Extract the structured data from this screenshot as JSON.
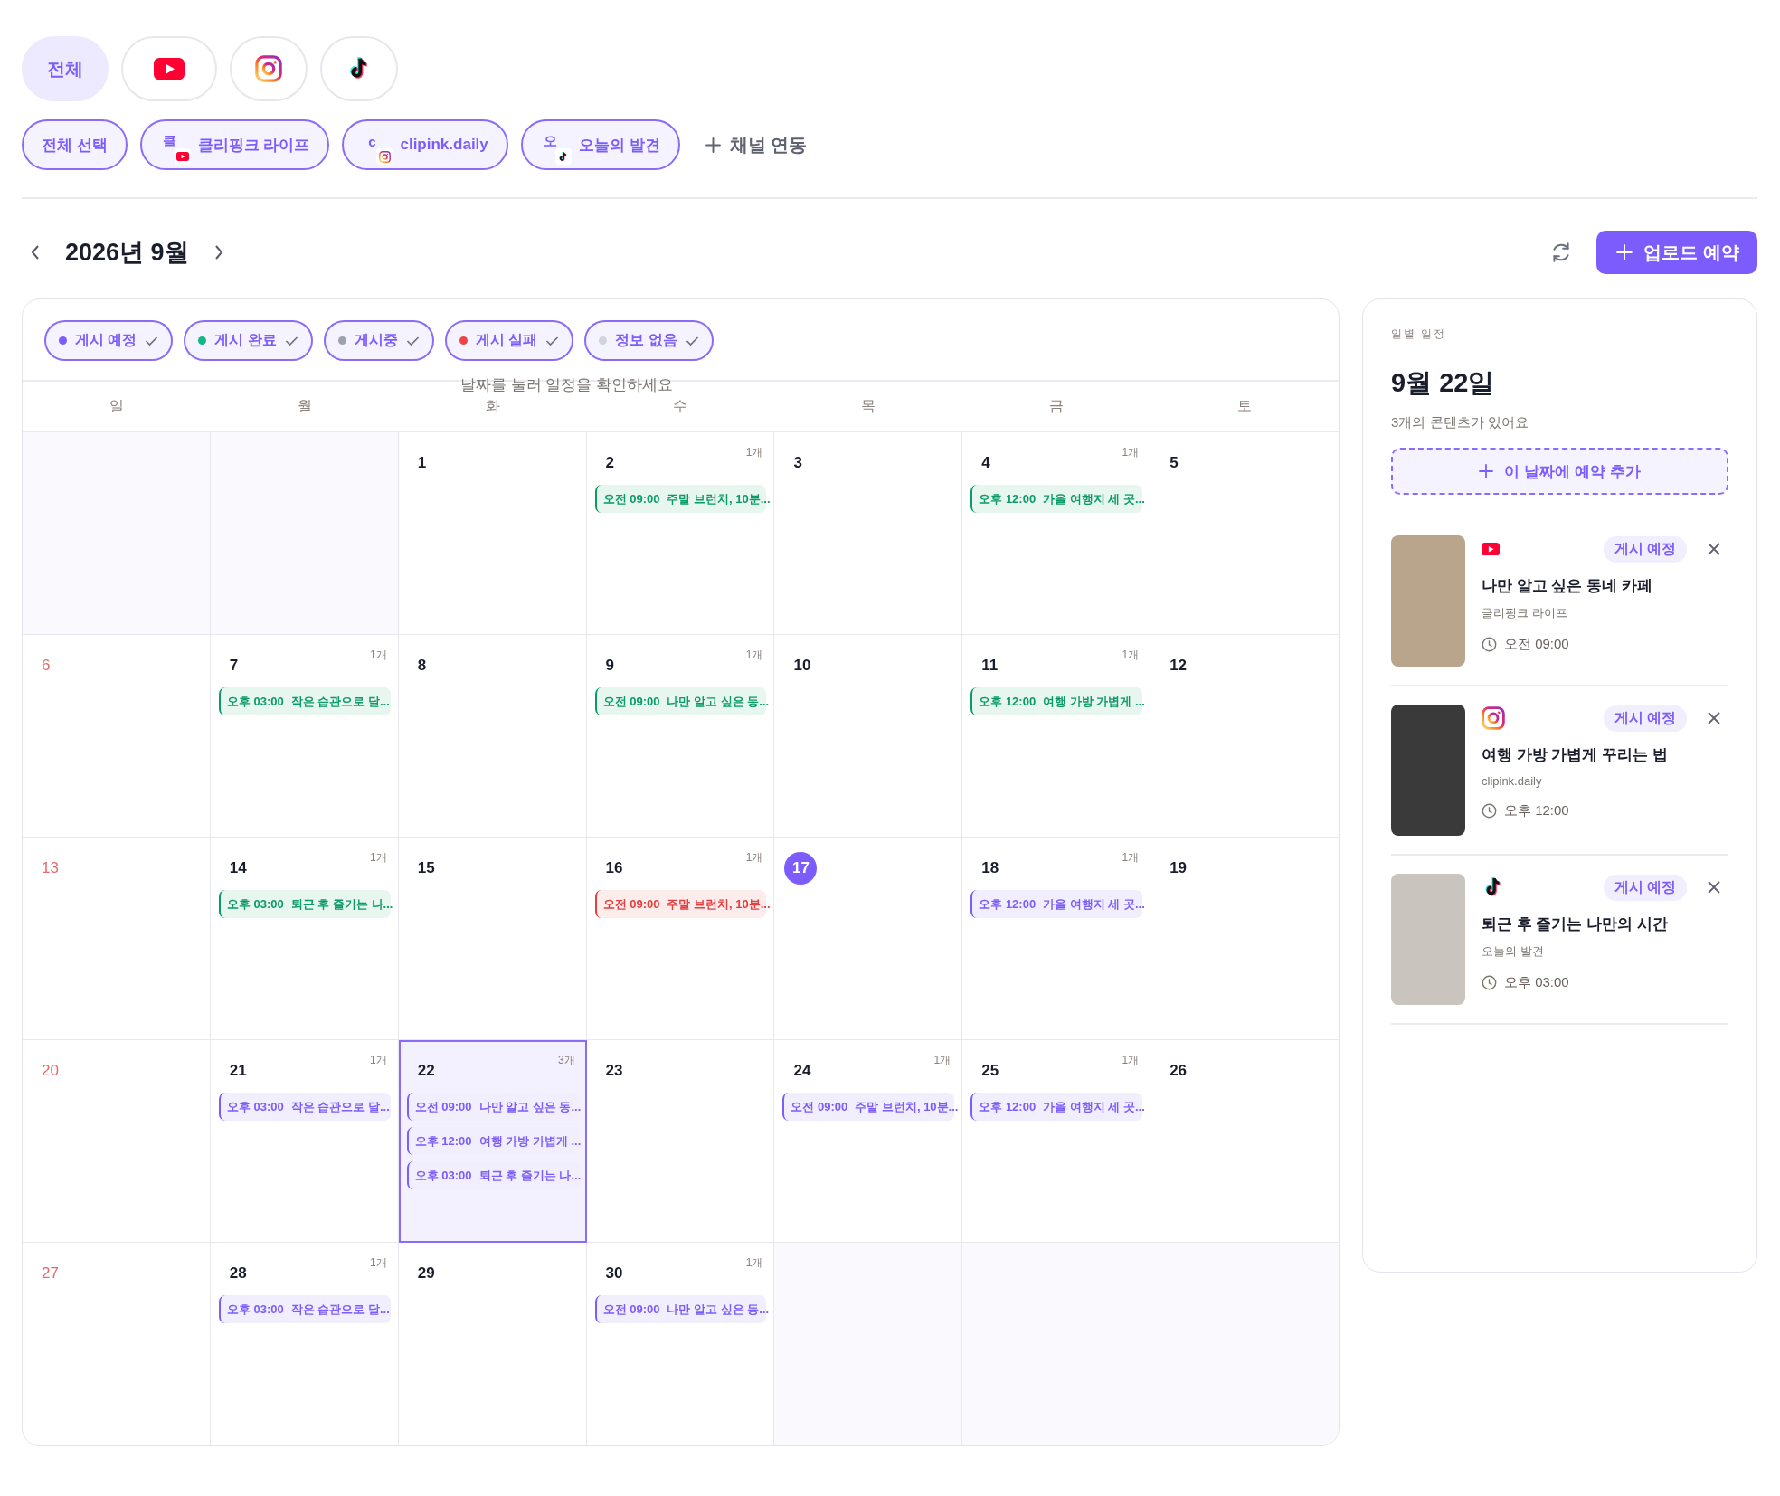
{
  "platform_tabs": [
    {
      "kind": "all",
      "label": "전체",
      "selected": true
    },
    {
      "kind": "youtube",
      "selected": false
    },
    {
      "kind": "instagram",
      "selected": false
    },
    {
      "kind": "tiktok",
      "selected": false
    }
  ],
  "channels": [
    {
      "kind": "all",
      "label": "전체 선택",
      "selected": true
    },
    {
      "kind": "youtube",
      "initial": "클",
      "label": "클리핑크 라이프",
      "selected": true
    },
    {
      "kind": "instagram",
      "initial": "c",
      "label": "clipink.daily",
      "selected": true
    },
    {
      "kind": "tiktok",
      "initial": "오",
      "label": "오늘의 발견",
      "selected": true
    }
  ],
  "link_channel": "채널 연동",
  "month_title": "2026년 9월",
  "upload_button": "업로드 예약",
  "calendar": {
    "filters": [
      {
        "label": "게시 예정",
        "color": "#7c5cfc",
        "checked": true
      },
      {
        "label": "게시 완료",
        "color": "#12b886",
        "checked": true
      },
      {
        "label": "게시중",
        "color": "#9ca3af",
        "checked": true
      },
      {
        "label": "게시 실패",
        "color": "#ef4444",
        "checked": true
      },
      {
        "label": "정보 없음",
        "color": "#d1d5db",
        "checked": true
      }
    ],
    "hint": "날짜를 눌러 일정을 확인하세요",
    "weekdays": [
      "일",
      "월",
      "화",
      "수",
      "목",
      "금",
      "토"
    ],
    "weeks": [
      [
        {
          "in_month": false
        },
        {
          "in_month": false
        },
        {
          "day": "1"
        },
        {
          "day": "2",
          "count": "1개",
          "events": [
            {
              "time": "오전 09:00",
              "title": "주말 브런치, 10분...",
              "kind": "done"
            }
          ]
        },
        {
          "day": "3"
        },
        {
          "day": "4",
          "count": "1개",
          "events": [
            {
              "time": "오후 12:00",
              "title": "가을 여행지 세 곳...",
              "kind": "done"
            }
          ]
        },
        {
          "day": "5"
        }
      ],
      [
        {
          "day": "6"
        },
        {
          "day": "7",
          "count": "1개",
          "events": [
            {
              "time": "오후 03:00",
              "title": "작은 습관으로 달...",
              "kind": "done"
            }
          ]
        },
        {
          "day": "8"
        },
        {
          "day": "9",
          "count": "1개",
          "events": [
            {
              "time": "오전 09:00",
              "title": "나만 알고 싶은 동...",
              "kind": "done"
            }
          ]
        },
        {
          "day": "10"
        },
        {
          "day": "11",
          "count": "1개",
          "events": [
            {
              "time": "오후 12:00",
              "title": "여행 가방 가볍게 ...",
              "kind": "done"
            }
          ]
        },
        {
          "day": "12"
        }
      ],
      [
        {
          "day": "13"
        },
        {
          "day": "14",
          "count": "1개",
          "events": [
            {
              "time": "오후 03:00",
              "title": "퇴근 후 즐기는 나...",
              "kind": "done"
            }
          ]
        },
        {
          "day": "15"
        },
        {
          "day": "16",
          "count": "1개",
          "events": [
            {
              "time": "오전 09:00",
              "title": "주말 브런치, 10분...",
              "kind": "failed"
            }
          ]
        },
        {
          "day": "17",
          "today": true
        },
        {
          "day": "18",
          "count": "1개",
          "events": [
            {
              "time": "오후 12:00",
              "title": "가을 여행지 세 곳...",
              "kind": "scheduled"
            }
          ]
        },
        {
          "day": "19"
        }
      ],
      [
        {
          "day": "20"
        },
        {
          "day": "21",
          "count": "1개",
          "events": [
            {
              "time": "오후 03:00",
              "title": "작은 습관으로 달...",
              "kind": "scheduled"
            }
          ]
        },
        {
          "day": "22",
          "selected": true,
          "count": "3개",
          "events": [
            {
              "time": "오전 09:00",
              "title": "나만 알고 싶은 동...",
              "kind": "scheduled"
            },
            {
              "time": "오후 12:00",
              "title": "여행 가방 가볍게 ...",
              "kind": "scheduled"
            },
            {
              "time": "오후 03:00",
              "title": "퇴근 후 즐기는 나...",
              "kind": "scheduled"
            }
          ]
        },
        {
          "day": "23"
        },
        {
          "day": "24",
          "count": "1개",
          "events": [
            {
              "time": "오전 09:00",
              "title": "주말 브런치, 10분...",
              "kind": "scheduled"
            }
          ]
        },
        {
          "day": "25",
          "count": "1개",
          "events": [
            {
              "time": "오후 12:00",
              "title": "가을 여행지 세 곳...",
              "kind": "scheduled"
            }
          ]
        },
        {
          "day": "26"
        }
      ],
      [
        {
          "day": "27"
        },
        {
          "day": "28",
          "count": "1개",
          "events": [
            {
              "time": "오후 03:00",
              "title": "작은 습관으로 달...",
              "kind": "scheduled"
            }
          ]
        },
        {
          "day": "29"
        },
        {
          "day": "30",
          "count": "1개",
          "events": [
            {
              "time": "오전 09:00",
              "title": "나만 알고 싶은 동...",
              "kind": "scheduled"
            }
          ]
        },
        {
          "in_month": false
        },
        {
          "in_month": false
        },
        {
          "in_month": false
        }
      ]
    ]
  },
  "day_panel": {
    "label": "일별 일정",
    "date": "9월 22일",
    "summary": "3개의 콘텐츠가 있어요",
    "add_button": "이 날짜에 예약 추가",
    "items": [
      {
        "kind": "youtube",
        "status": "게시 예정",
        "title": "나만 알고 싶은 동네 카페",
        "channel": "클리핑크 라이프",
        "time": "오전 09:00"
      },
      {
        "kind": "instagram",
        "status": "게시 예정",
        "title": "여행 가방 가볍게 꾸리는 법",
        "channel": "clipink.daily",
        "time": "오후 12:00"
      },
      {
        "kind": "tiktok",
        "status": "게시 예정",
        "title": "퇴근 후 즐기는 나만의 시간",
        "channel": "오늘의 발견",
        "time": "오후 03:00"
      }
    ]
  }
}
